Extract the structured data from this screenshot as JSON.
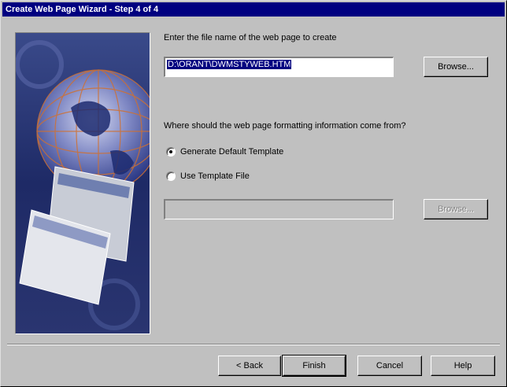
{
  "window": {
    "title": "Create Web Page Wizard - Step 4 of 4"
  },
  "filename": {
    "prompt": "Enter the file name of the web page to create",
    "value": "D:\\ORANT\\DWMSTYWEB.HTM",
    "browse_label": "Browse..."
  },
  "formatting": {
    "question": "Where should the web page formatting information come from?",
    "options": [
      {
        "label": "Generate Default Template",
        "checked": true
      },
      {
        "label": "Use Template File",
        "checked": false
      }
    ],
    "template_path": "",
    "template_browse_label": "Browse..."
  },
  "footer": {
    "back_label": "< Back",
    "finish_label": "Finish",
    "cancel_label": "Cancel",
    "help_label": "Help"
  },
  "colors": {
    "title_bar": "#000080",
    "face": "#c0c0c0",
    "selection": "#000080"
  }
}
